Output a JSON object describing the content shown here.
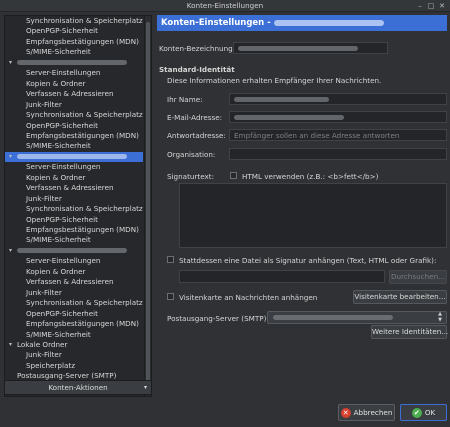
{
  "window": {
    "title": "Konten-Einstellungen",
    "minimize_glyph": "–",
    "maximize_glyph": "□",
    "close_glyph": "✕"
  },
  "sidebar": {
    "rows": [
      {
        "label": "Synchronisation & Speicherplatz",
        "indent": 1
      },
      {
        "label": "OpenPGP-Sicherheit",
        "indent": 1
      },
      {
        "label": "Empfangsbestätigungen (MDN)",
        "indent": 1
      },
      {
        "label": "S/MIME-Sicherheit",
        "indent": 1
      },
      {
        "label": "",
        "indent": 0,
        "expander": "▾",
        "blurred": true
      },
      {
        "label": "Server-Einstellungen",
        "indent": 1
      },
      {
        "label": "Kopien & Ordner",
        "indent": 1
      },
      {
        "label": "Verfassen & Adressieren",
        "indent": 1
      },
      {
        "label": "Junk-Filter",
        "indent": 1
      },
      {
        "label": "Synchronisation & Speicherplatz",
        "indent": 1
      },
      {
        "label": "OpenPGP-Sicherheit",
        "indent": 1
      },
      {
        "label": "Empfangsbestätigungen (MDN)",
        "indent": 1
      },
      {
        "label": "S/MIME-Sicherheit",
        "indent": 1
      },
      {
        "label": "",
        "indent": 0,
        "expander": "▾",
        "blurred": true,
        "selected": true
      },
      {
        "label": "Server-Einstellungen",
        "indent": 1
      },
      {
        "label": "Kopien & Ordner",
        "indent": 1
      },
      {
        "label": "Verfassen & Adressieren",
        "indent": 1
      },
      {
        "label": "Junk-Filter",
        "indent": 1
      },
      {
        "label": "Synchronisation & Speicherplatz",
        "indent": 1
      },
      {
        "label": "OpenPGP-Sicherheit",
        "indent": 1
      },
      {
        "label": "Empfangsbestätigungen (MDN)",
        "indent": 1
      },
      {
        "label": "S/MIME-Sicherheit",
        "indent": 1
      },
      {
        "label": "",
        "indent": 0,
        "expander": "▾",
        "blurred": true
      },
      {
        "label": "Server-Einstellungen",
        "indent": 1
      },
      {
        "label": "Kopien & Ordner",
        "indent": 1
      },
      {
        "label": "Verfassen & Adressieren",
        "indent": 1
      },
      {
        "label": "Junk-Filter",
        "indent": 1
      },
      {
        "label": "Synchronisation & Speicherplatz",
        "indent": 1
      },
      {
        "label": "OpenPGP-Sicherheit",
        "indent": 1
      },
      {
        "label": "Empfangsbestätigungen (MDN)",
        "indent": 1
      },
      {
        "label": "S/MIME-Sicherheit",
        "indent": 1
      },
      {
        "label": "Lokale Ordner",
        "indent": 0,
        "expander": "▾"
      },
      {
        "label": "Junk-Filter",
        "indent": 1
      },
      {
        "label": "Speicherplatz",
        "indent": 1
      },
      {
        "label": "Postausgang-Server (SMTP)",
        "indent": 0
      }
    ],
    "account_actions": "Konten-Aktionen",
    "account_actions_arrow": "▾"
  },
  "main": {
    "header_title": "Konten-Einstellungen - ",
    "account_name_label": "Konten-Bezeichnung:",
    "section_title": "Standard-Identität",
    "section_desc": "Diese Informationen erhalten Empfänger Ihrer Nachrichten.",
    "name_label": "Ihr Name:",
    "email_label": "E-Mail-Adresse:",
    "reply_label": "Antwortadresse:",
    "reply_placeholder": "Empfänger sollen an diese Adresse antworten",
    "org_label": "Organisation:",
    "sig_label": "Signaturtext:",
    "html_label": "HTML verwenden (z.B.: <b>fett</b>)",
    "sig_file_label": "Stattdessen eine Datei als Signatur anhängen (Text, HTML oder Grafik):",
    "browse_button": "Durchsuchen...",
    "vcard_label": "Visitenkarte an Nachrichten anhängen",
    "vcard_button": "Visitenkarte bearbeiten...",
    "smtp_label": "Postausgang-Server (SMTP):",
    "smtp_spin": [
      "▲",
      "▼"
    ],
    "more_identities_button": "Weitere Identitäten..."
  },
  "footer": {
    "cancel": "Abbrechen",
    "ok": "OK",
    "cancel_icon": "✕",
    "ok_icon": "✔"
  },
  "colors": {
    "accent": "#3b6fd6",
    "cancel_icon": "#d9412f",
    "ok_icon": "#4caf50"
  }
}
